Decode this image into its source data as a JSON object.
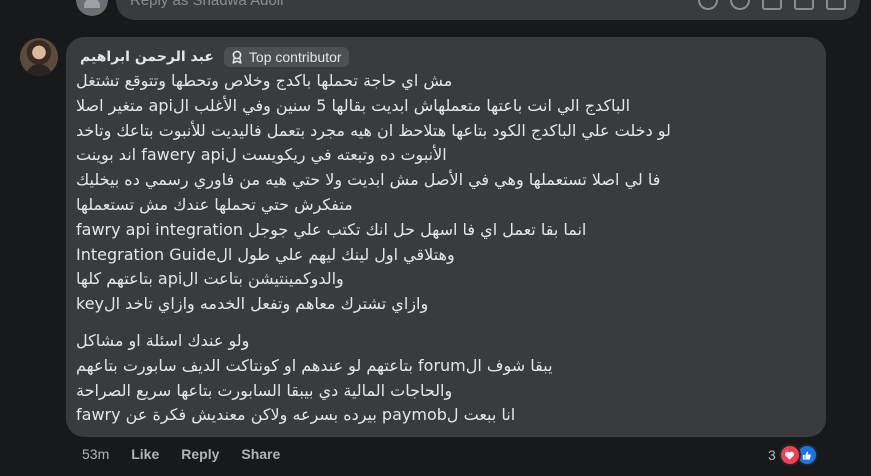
{
  "reply_box": {
    "placeholder": "Reply as Shadwa Adoli"
  },
  "comment": {
    "author": "عبد الرحمن ابراهيم",
    "badge": "Top contributor",
    "lines_block1": [
      "مش اي حاجة تحملها باكدج وخلاص وتحطها وتتوقع تشتغل",
      "الباكدج الي انت باعتها متعملهاش ابديت بقالها 5 سنين وفي الأغلب الapi متغير اصلا",
      "لو دخلت علي الباكدج الكود بتاعها هتلاحظ ان هيه مجرد بتعمل فاليديت للأنبوت بتاعك وتاخد",
      "الأنبوت ده وتبعته في ريكويست لfawery api اند بوينت",
      "فا لي اصلا تستعملها وهي في الأصل مش ابديت ولا حتي هيه من فاوري رسمي ده بيخليك",
      "متفكرش حتي تحملها عندك مش تستعملها",
      "انما بقا تعمل اي فا اسهل حل انك تكتب علي جوجل fawry api integration",
      "وهتلاقي اول لينك ليهم علي طول الIntegration Guide",
      "والدوكمينتيشن بتاعت الapi بتاعتهم كلها",
      "وازاي تشترك معاهم وتفعل الخدمه وازاي تاخد الkey"
    ],
    "lines_block2": [
      "ولو عندك اسئلة او مشاكل",
      "يبقا شوف الforum بتاعتهم لو عندهم او كونتاكت الديف سابورت بتاعهم",
      "والحاجات المالية دي بيبقا السابورت بتاعها سريع الصراحة",
      "انا ببعت لpaymob بيرده بسرعه ولاكن معنديش فكرة عن fawry"
    ],
    "time": "53m",
    "actions": [
      "Like",
      "Reply",
      "Share"
    ],
    "reaction_count": "3"
  },
  "colors": {
    "background": "#18191a",
    "bubble": "#3a3b3c",
    "text": "#e4e6eb",
    "secondary_text": "#b0b3b8",
    "love": "#f33e58",
    "like": "#1b74e4"
  },
  "icons": {
    "badge": "contributor-badge-icon",
    "reactions": [
      "love-reaction-icon",
      "like-reaction-icon"
    ]
  }
}
